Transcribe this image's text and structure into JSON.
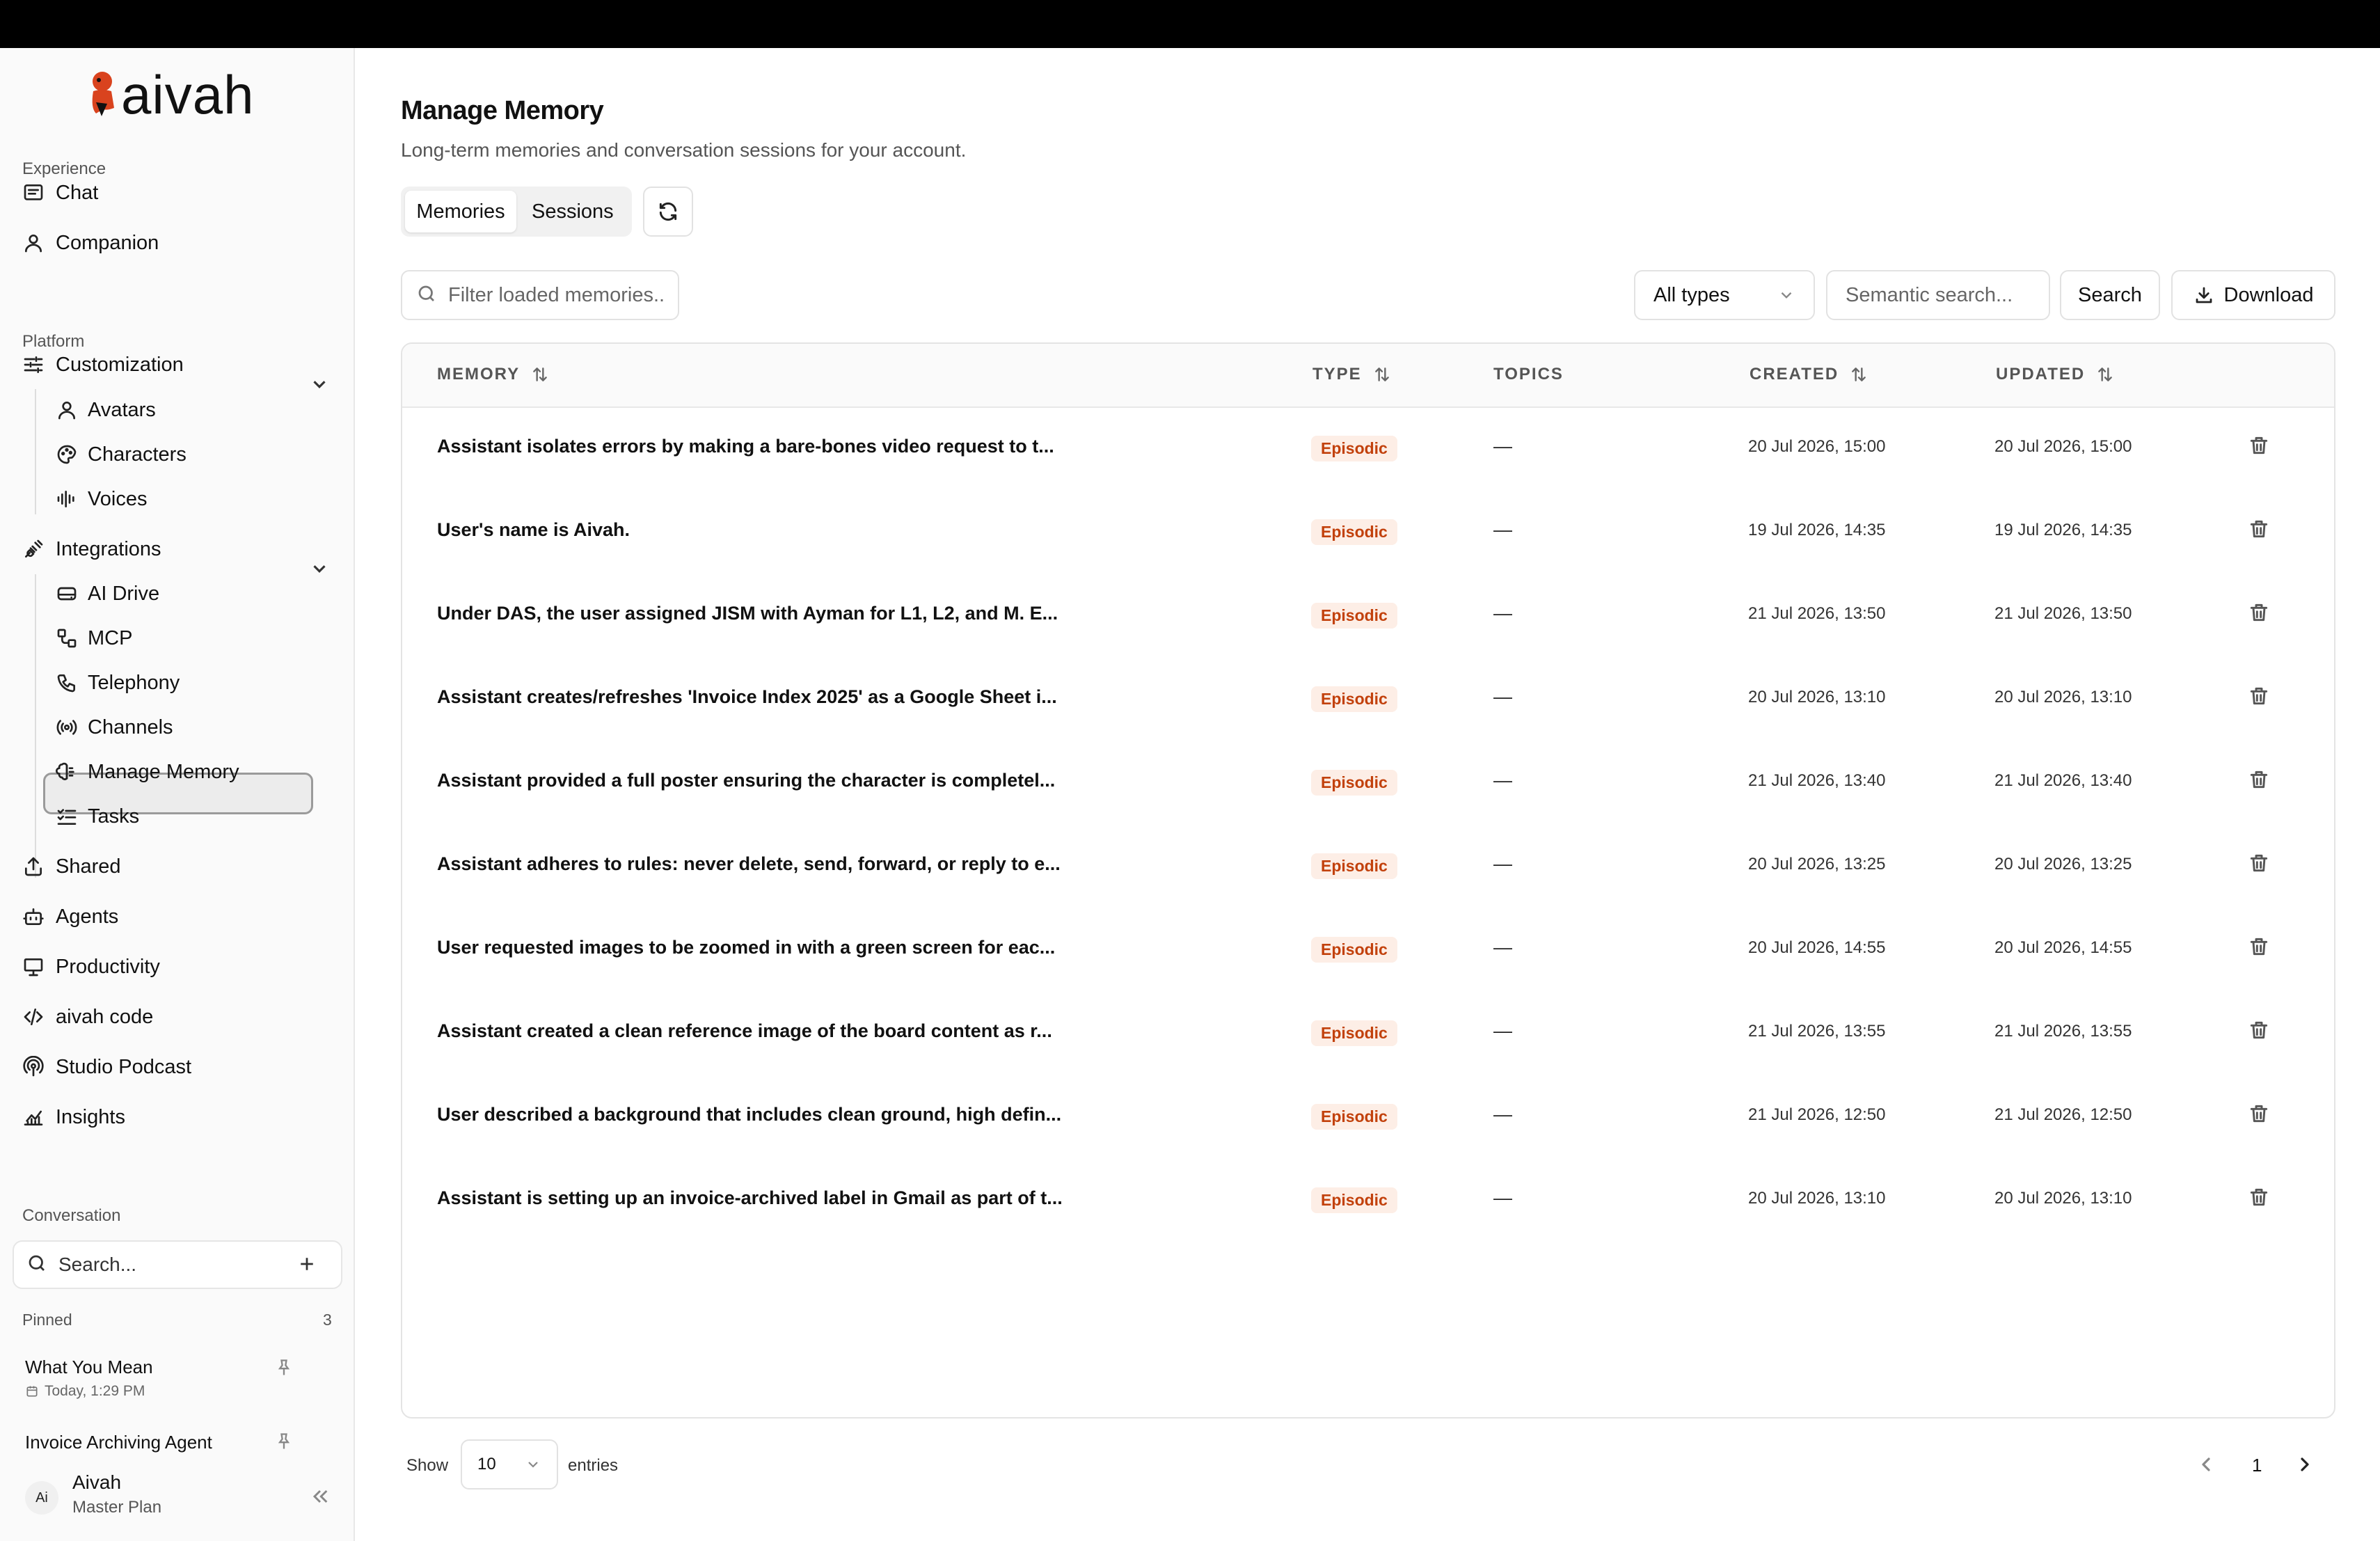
{
  "brand": {
    "name": "aivah",
    "mark_color": "#d9431e"
  },
  "sidebar": {
    "sections": {
      "experience": "Experience",
      "platform": "Platform",
      "conversation": "Conversation"
    },
    "experience_items": [
      {
        "label": "Chat",
        "icon": "chat-icon"
      },
      {
        "label": "Companion",
        "icon": "user-icon"
      }
    ],
    "customization": {
      "label": "Customization",
      "children": [
        "Avatars",
        "Characters",
        "Voices"
      ]
    },
    "integrations": {
      "label": "Integrations",
      "children": [
        "AI Drive",
        "MCP",
        "Telephony",
        "Channels",
        "Manage Memory",
        "Tasks"
      ]
    },
    "platform_items": [
      "Shared",
      "Agents",
      "Productivity",
      "aivah code",
      "Studio Podcast",
      "Insights"
    ],
    "active_item": "Manage Memory",
    "search_placeholder": "Search...",
    "pinned_label": "Pinned",
    "pinned_count": "3",
    "pinned": [
      {
        "title": "What You Mean",
        "meta": "Today, 1:29 PM"
      },
      {
        "title": "Invoice Archiving Agent",
        "meta": ""
      }
    ],
    "user": {
      "initials": "Ai",
      "name": "Aivah",
      "plan": "Master Plan"
    }
  },
  "main": {
    "title": "Manage Memory",
    "subtitle": "Long-term memories and conversation sessions for your account.",
    "tabs": [
      {
        "label": "Memories",
        "active": true
      },
      {
        "label": "Sessions",
        "active": false
      }
    ],
    "filter_placeholder": "Filter loaded memories...",
    "type_select": "All types",
    "semantic_placeholder": "Semantic search...",
    "search_button": "Search",
    "download_button": "Download",
    "columns": [
      "MEMORY",
      "TYPE",
      "TOPICS",
      "CREATED",
      "UPDATED"
    ],
    "rows": [
      {
        "memory": "Assistant isolates errors by making a bare-bones video request to t...",
        "type": "Episodic",
        "topics": "—",
        "created": "20 Jul 2026, 15:00",
        "updated": "20 Jul 2026, 15:00"
      },
      {
        "memory": "User's name is Aivah.",
        "type": "Episodic",
        "topics": "—",
        "created": "19 Jul 2026, 14:35",
        "updated": "19 Jul 2026, 14:35"
      },
      {
        "memory": "Under DAS, the user assigned JISM with Ayman for L1, L2, and M. E...",
        "type": "Episodic",
        "topics": "—",
        "created": "21 Jul 2026, 13:50",
        "updated": "21 Jul 2026, 13:50"
      },
      {
        "memory": "Assistant creates/refreshes 'Invoice Index 2025' as a Google Sheet i...",
        "type": "Episodic",
        "topics": "—",
        "created": "20 Jul 2026, 13:10",
        "updated": "20 Jul 2026, 13:10"
      },
      {
        "memory": "Assistant provided a full poster ensuring the character is completel...",
        "type": "Episodic",
        "topics": "—",
        "created": "21 Jul 2026, 13:40",
        "updated": "21 Jul 2026, 13:40"
      },
      {
        "memory": "Assistant adheres to rules: never delete, send, forward, or reply to e...",
        "type": "Episodic",
        "topics": "—",
        "created": "20 Jul 2026, 13:25",
        "updated": "20 Jul 2026, 13:25"
      },
      {
        "memory": "User requested images to be zoomed in with a green screen for eac...",
        "type": "Episodic",
        "topics": "—",
        "created": "20 Jul 2026, 14:55",
        "updated": "20 Jul 2026, 14:55"
      },
      {
        "memory": "Assistant created a clean reference image of the board content as r...",
        "type": "Episodic",
        "topics": "—",
        "created": "21 Jul 2026, 13:55",
        "updated": "21 Jul 2026, 13:55"
      },
      {
        "memory": "User described a background that includes clean ground, high defin...",
        "type": "Episodic",
        "topics": "—",
        "created": "21 Jul 2026, 12:50",
        "updated": "21 Jul 2026, 12:50"
      },
      {
        "memory": "Assistant is setting up an invoice-archived label in Gmail as part of t...",
        "type": "Episodic",
        "topics": "—",
        "created": "20 Jul 2026, 13:10",
        "updated": "20 Jul 2026, 13:10"
      }
    ],
    "footer": {
      "show": "Show",
      "page_size": "10",
      "entries": "entries",
      "current_page": "1"
    }
  }
}
